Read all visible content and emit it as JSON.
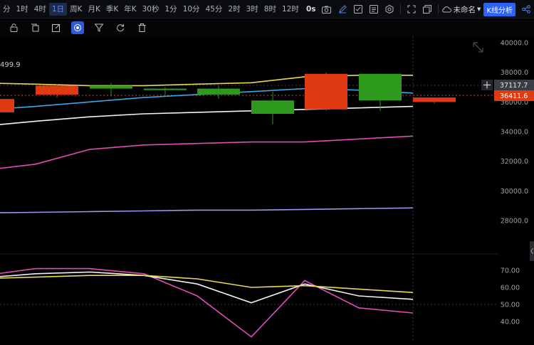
{
  "toolbar": {
    "timeframes": [
      "分",
      "1时",
      "4时",
      "1日",
      "周K",
      "月K",
      "季K",
      "年K",
      "30秒",
      "1分",
      "10分",
      "45分",
      "2时",
      "3时",
      "8时",
      "12时"
    ],
    "active_timeframe": "1日",
    "countdown": "0s",
    "template_name": "未命名",
    "kline_button": "K线分析"
  },
  "drawing_tools": [
    "lock-icon",
    "copy-icon",
    "edit-icon",
    "brush-icon",
    "filter-icon",
    "refresh-icon",
    "trash-icon"
  ],
  "main_chart": {
    "partial_label": "499.9",
    "y_ticks": [
      "40000.0",
      "38000.0",
      "36000.0",
      "34000.0",
      "32000.0",
      "30000.0",
      "28000.0"
    ],
    "crosshair_price": "37117.7",
    "last_price": "36411.6",
    "candles": [
      {
        "o": 36200,
        "c": 35300,
        "h": 36300,
        "l": 35200,
        "color": "red"
      },
      {
        "o": 37100,
        "c": 36500,
        "h": 37200,
        "l": 36300,
        "color": "red"
      },
      {
        "o": 36900,
        "c": 37100,
        "h": 37300,
        "l": 36400,
        "color": "green"
      },
      {
        "o": 36800,
        "c": 36900,
        "h": 37000,
        "l": 36500,
        "color": "green"
      },
      {
        "o": 36500,
        "c": 36900,
        "h": 37100,
        "l": 36200,
        "color": "green"
      },
      {
        "o": 35200,
        "c": 36100,
        "h": 36700,
        "l": 34500,
        "color": "green"
      },
      {
        "o": 35500,
        "c": 37900,
        "h": 38000,
        "l": 35400,
        "color": "red"
      },
      {
        "o": 36100,
        "c": 37900,
        "h": 37900,
        "l": 35400,
        "color": "green"
      },
      {
        "o": 36300,
        "c": 36000,
        "h": 36300,
        "l": 35900,
        "color": "red"
      }
    ],
    "ma_yellow": [
      37300,
      37200,
      37100,
      37100,
      37200,
      37300,
      37700,
      37800,
      37800
    ],
    "ma_blue": [
      35400,
      35700,
      36000,
      36300,
      36500,
      36700,
      36900,
      36800,
      36600
    ],
    "ma_white": [
      34300,
      34700,
      35000,
      35200,
      35300,
      35400,
      35500,
      35600,
      35700
    ],
    "ma_pink": [
      31300,
      31800,
      32800,
      33100,
      33200,
      33300,
      33300,
      33500,
      33700
    ],
    "ma_purple": [
      28500,
      28550,
      28600,
      28650,
      28700,
      28700,
      28750,
      28800,
      28850
    ]
  },
  "sub_chart": {
    "y_ticks": [
      "70.00",
      "60.00",
      "50.00",
      "40.00"
    ],
    "yellow": [
      65,
      66,
      67,
      67,
      65,
      60,
      61,
      59,
      57
    ],
    "white": [
      65,
      68,
      69,
      67,
      62,
      51,
      62,
      55,
      53
    ],
    "pink": [
      66,
      71,
      71,
      68,
      55,
      31,
      64,
      48,
      45
    ]
  },
  "colors": {
    "up": "#2d9a1e",
    "down": "#e03a12",
    "ma_yellow": "#e6d857",
    "ma_blue": "#3ba7e8",
    "ma_white": "#f2f2f2",
    "ma_pink": "#e24bb8",
    "ma_purple": "#a98df0",
    "accent": "#2a63f5"
  }
}
